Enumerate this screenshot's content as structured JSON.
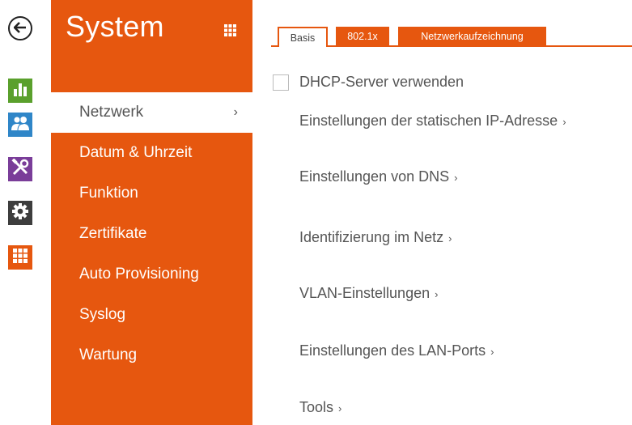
{
  "panel": {
    "title": "System",
    "color": "#e6570f"
  },
  "rail": [
    {
      "icon": "back-arrow-icon"
    },
    {
      "icon": "chart-icon",
      "color": "#5aa02c"
    },
    {
      "icon": "users-icon",
      "color": "#2f86c8"
    },
    {
      "icon": "tools-icon",
      "color": "#7a3d99"
    },
    {
      "icon": "gear-icon",
      "color": "#3d3d3d"
    },
    {
      "icon": "grid-icon",
      "color": "#e6570f"
    }
  ],
  "nav": {
    "items": [
      {
        "label": "Netzwerk",
        "arrow": "›"
      },
      {
        "label": "Datum & Uhrzeit"
      },
      {
        "label": "Funktion"
      },
      {
        "label": "Zertifikate"
      },
      {
        "label": "Auto Provisioning"
      },
      {
        "label": "Syslog"
      },
      {
        "label": "Wartung"
      }
    ]
  },
  "tabs": [
    {
      "label": "Basis"
    },
    {
      "label": "802.1x"
    },
    {
      "label": "Netzwerkaufzeichnung"
    }
  ],
  "content": {
    "dhcp_label": "DHCP-Server verwenden",
    "links": [
      {
        "label": "Einstellungen der statischen IP-Adresse",
        "arrow": "›"
      },
      {
        "label": "Einstellungen von DNS",
        "arrow": "›"
      },
      {
        "label": "Identifizierung im Netz",
        "arrow": "›"
      },
      {
        "label": "VLAN-Einstellungen",
        "arrow": "›"
      },
      {
        "label": "Einstellungen des LAN-Ports",
        "arrow": "›"
      },
      {
        "label": "Tools",
        "arrow": "›"
      }
    ]
  }
}
